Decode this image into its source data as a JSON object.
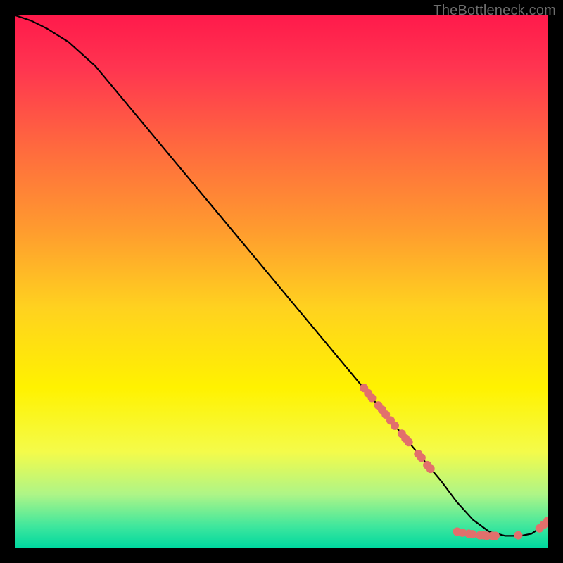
{
  "watermark": "TheBottleneck.com",
  "chart_data": {
    "type": "line",
    "title": "",
    "xlabel": "",
    "ylabel": "",
    "xlim": [
      0,
      100
    ],
    "ylim": [
      0,
      100
    ],
    "grid": false,
    "legend": false,
    "background_gradient": {
      "stops": [
        {
          "offset": 0.0,
          "color": "#ff1a4b"
        },
        {
          "offset": 0.1,
          "color": "#ff3550"
        },
        {
          "offset": 0.25,
          "color": "#ff6a3e"
        },
        {
          "offset": 0.4,
          "color": "#ff9a2f"
        },
        {
          "offset": 0.55,
          "color": "#ffd21f"
        },
        {
          "offset": 0.7,
          "color": "#fff200"
        },
        {
          "offset": 0.82,
          "color": "#f4fb4a"
        },
        {
          "offset": 0.9,
          "color": "#aef587"
        },
        {
          "offset": 0.96,
          "color": "#3fe79d"
        },
        {
          "offset": 1.0,
          "color": "#00d89f"
        }
      ]
    },
    "series": [
      {
        "name": "curve",
        "x": [
          0,
          3,
          6,
          10,
          15,
          20,
          25,
          30,
          35,
          40,
          45,
          50,
          55,
          60,
          65,
          70,
          75,
          80,
          83,
          86,
          89,
          92,
          95,
          97,
          98.5,
          100
        ],
        "y": [
          100,
          99,
          97.5,
          95,
          90.5,
          84.5,
          78.5,
          72.5,
          66.5,
          60.5,
          54.5,
          48.5,
          42.5,
          36.5,
          30.5,
          24.5,
          18.5,
          12.5,
          8.5,
          5.2,
          3.0,
          2.2,
          2.2,
          2.6,
          3.6,
          5.0
        ]
      }
    ],
    "markers": [
      {
        "x": 65.5,
        "y": 30.0
      },
      {
        "x": 66.3,
        "y": 29.0
      },
      {
        "x": 67.0,
        "y": 28.1
      },
      {
        "x": 68.2,
        "y": 26.7
      },
      {
        "x": 68.9,
        "y": 25.9
      },
      {
        "x": 69.6,
        "y": 25.0
      },
      {
        "x": 70.5,
        "y": 23.9
      },
      {
        "x": 71.3,
        "y": 22.9
      },
      {
        "x": 72.6,
        "y": 21.4
      },
      {
        "x": 73.3,
        "y": 20.5
      },
      {
        "x": 73.9,
        "y": 19.8
      },
      {
        "x": 75.7,
        "y": 17.6
      },
      {
        "x": 76.3,
        "y": 16.9
      },
      {
        "x": 77.4,
        "y": 15.5
      },
      {
        "x": 78.0,
        "y": 14.8
      },
      {
        "x": 83.0,
        "y": 3.0
      },
      {
        "x": 84.0,
        "y": 2.8
      },
      {
        "x": 85.2,
        "y": 2.6
      },
      {
        "x": 85.9,
        "y": 2.5
      },
      {
        "x": 87.3,
        "y": 2.3
      },
      {
        "x": 88.0,
        "y": 2.3
      },
      {
        "x": 88.6,
        "y": 2.2
      },
      {
        "x": 89.6,
        "y": 2.2
      },
      {
        "x": 90.2,
        "y": 2.2
      },
      {
        "x": 94.5,
        "y": 2.3
      },
      {
        "x": 98.5,
        "y": 3.6
      },
      {
        "x": 99.3,
        "y": 4.3
      },
      {
        "x": 100.0,
        "y": 5.0
      }
    ],
    "marker_style": {
      "color": "#e2706c",
      "radius_px": 6
    }
  }
}
